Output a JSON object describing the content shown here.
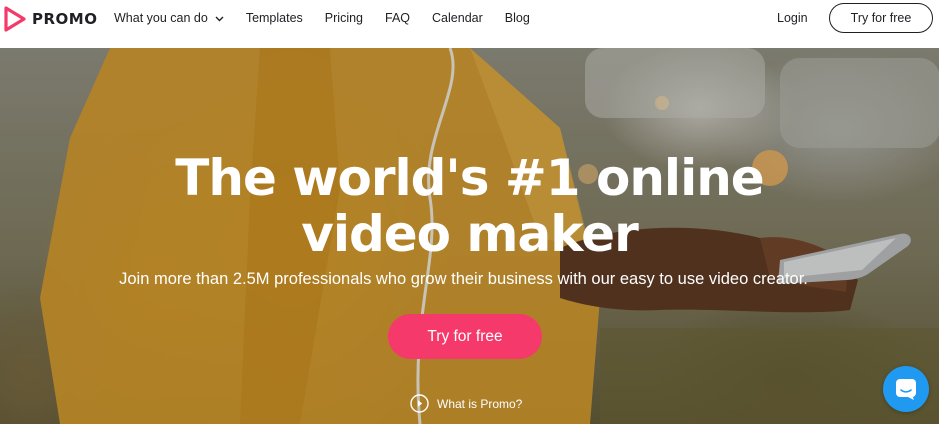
{
  "brand": {
    "name": "PROMO",
    "logo_color": "#f5396b"
  },
  "nav": {
    "items": [
      {
        "label": "What you can do",
        "has_dropdown": true
      },
      {
        "label": "Templates"
      },
      {
        "label": "Pricing"
      },
      {
        "label": "FAQ"
      },
      {
        "label": "Calendar"
      },
      {
        "label": "Blog"
      }
    ],
    "login_label": "Login",
    "cta_label": "Try for free"
  },
  "hero": {
    "headline_line1": "The world's #1 online",
    "headline_line2": "video maker",
    "subheadline": "Join more than 2.5M professionals who grow their business with our easy to use video creator.",
    "cta_label": "Try for free",
    "cta_color": "#f5396b",
    "secondary_link": "What is Promo?"
  },
  "chat": {
    "icon": "chat-icon",
    "color": "#1f9af0"
  }
}
